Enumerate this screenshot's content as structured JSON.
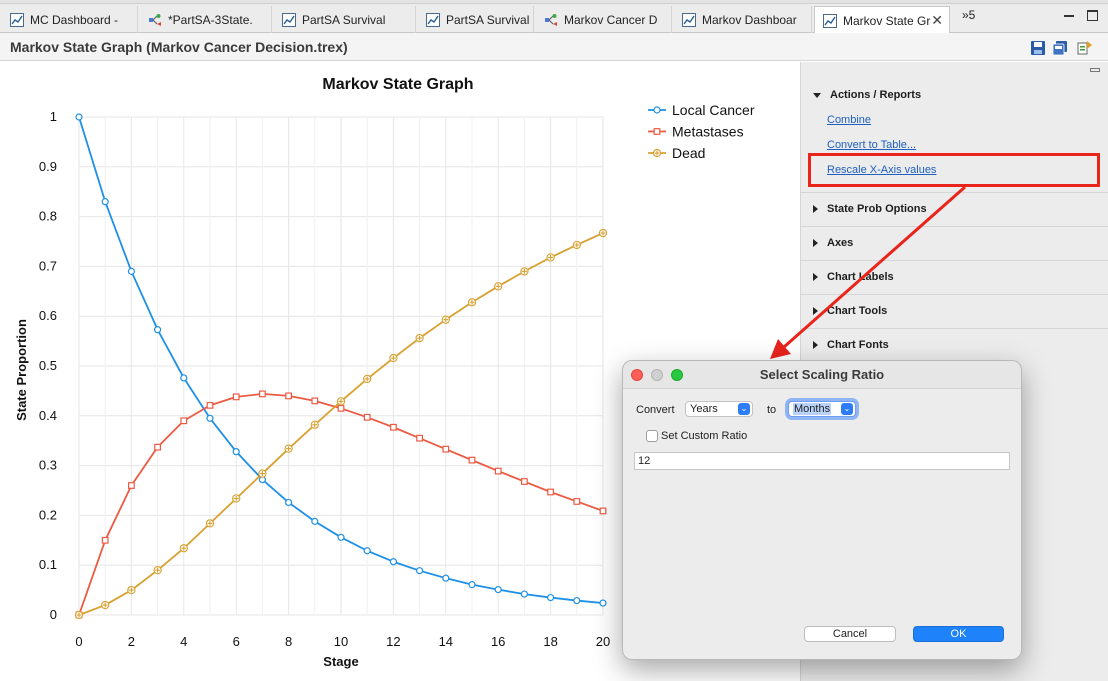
{
  "tabs": [
    {
      "label": "MC Dashboard -",
      "icon": "chart-icon",
      "active": false
    },
    {
      "label": "*PartSA-3State.",
      "icon": "tree-model-icon",
      "active": false
    },
    {
      "label": "PartSA Survival",
      "icon": "chart-icon",
      "active": false
    },
    {
      "label": "PartSA Survival",
      "icon": "chart-icon",
      "active": false
    },
    {
      "label": "Markov Cancer D",
      "icon": "tree-model-icon",
      "active": false
    },
    {
      "label": "Markov Dashboar",
      "icon": "chart-icon",
      "active": false
    },
    {
      "label": "Markov State Gr",
      "icon": "chart-icon",
      "active": true
    }
  ],
  "tabs_overflow": {
    "label": "»5"
  },
  "titlebar": {
    "title": "Markov State Graph (Markov Cancer Decision.trex)"
  },
  "chart_data": {
    "type": "line",
    "title": "Markov State Graph",
    "xlabel": "Stage",
    "ylabel": "State Proportion",
    "xlim": [
      0,
      20
    ],
    "ylim": [
      0,
      1
    ],
    "x_ticks": [
      "0",
      "2",
      "4",
      "6",
      "8",
      "10",
      "12",
      "14",
      "16",
      "18",
      "20"
    ],
    "y_ticks": [
      "0",
      "0.1",
      "0.2",
      "0.3",
      "0.4",
      "0.5",
      "0.6",
      "0.7",
      "0.8",
      "0.9",
      "1"
    ],
    "grid": true,
    "legend": "top-right",
    "x": [
      0,
      1,
      2,
      3,
      4,
      5,
      6,
      7,
      8,
      9,
      10,
      11,
      12,
      13,
      14,
      15,
      16,
      17,
      18,
      19,
      20
    ],
    "series": [
      {
        "name": "Local Cancer",
        "color": "#1e90e6",
        "marker": "circle",
        "values": [
          1.0,
          0.83,
          0.69,
          0.573,
          0.476,
          0.395,
          0.328,
          0.272,
          0.226,
          0.188,
          0.156,
          0.129,
          0.107,
          0.089,
          0.074,
          0.061,
          0.051,
          0.042,
          0.035,
          0.029,
          0.024
        ]
      },
      {
        "name": "Metastases",
        "color": "#ec5a43",
        "marker": "square",
        "values": [
          0.0,
          0.15,
          0.26,
          0.337,
          0.39,
          0.421,
          0.438,
          0.444,
          0.44,
          0.43,
          0.415,
          0.397,
          0.377,
          0.355,
          0.333,
          0.311,
          0.289,
          0.268,
          0.247,
          0.228,
          0.209
        ]
      },
      {
        "name": "Dead",
        "color": "#d8a02f",
        "marker": "plus",
        "values": [
          0.0,
          0.02,
          0.05,
          0.09,
          0.134,
          0.184,
          0.234,
          0.284,
          0.334,
          0.382,
          0.429,
          0.474,
          0.516,
          0.556,
          0.593,
          0.628,
          0.66,
          0.69,
          0.718,
          0.743,
          0.767
        ]
      }
    ]
  },
  "panel": {
    "actions_title": "Actions / Reports",
    "combine": "Combine",
    "convert": "Convert to Table...",
    "rescale": "Rescale X-Axis values",
    "sections": [
      "State Prob Options",
      "Axes",
      "Chart Labels",
      "Chart Tools",
      "Chart Fonts"
    ]
  },
  "dialog": {
    "title": "Select Scaling Ratio",
    "convert_label": "Convert",
    "from_value": "Years",
    "to_label": "to",
    "to_value": "Months",
    "custom_ratio_label": "Set Custom Ratio",
    "custom_ratio_checked": false,
    "ratio_value": "12",
    "cancel_label": "Cancel",
    "ok_label": "OK"
  },
  "colors": {
    "highlight": "#e8241b",
    "link": "#1f5fbf",
    "ok_button": "#1e82fb"
  }
}
